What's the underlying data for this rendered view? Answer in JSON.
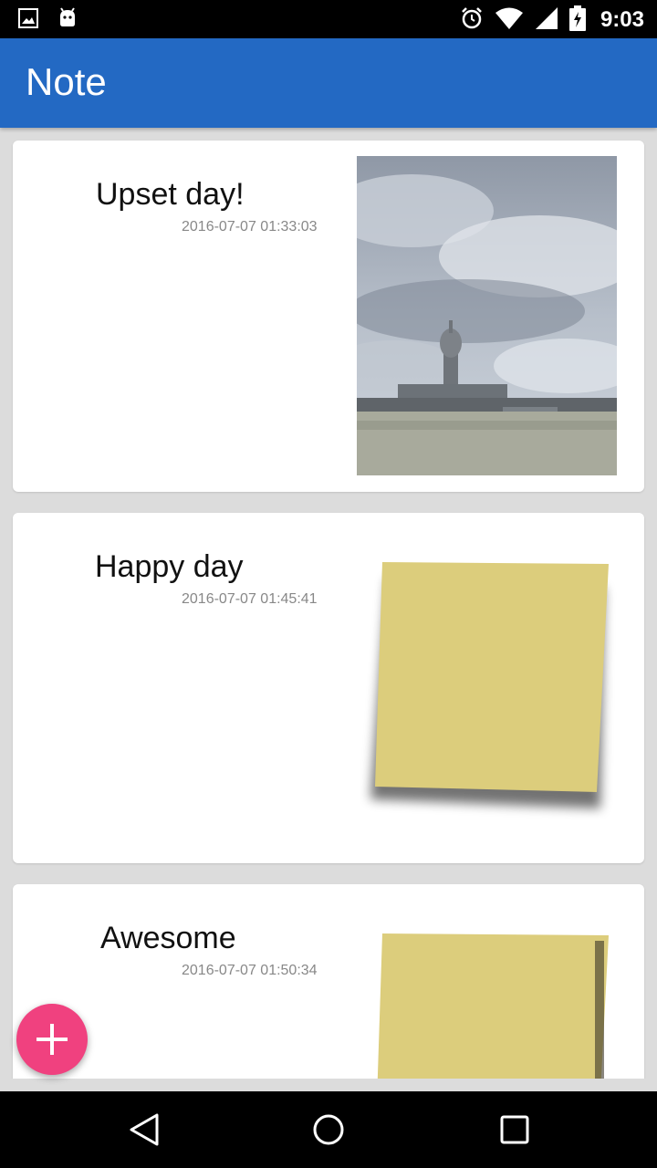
{
  "status_bar": {
    "time": "9:03",
    "left_icons": [
      "gallery-icon",
      "android-icon"
    ],
    "right_icons": [
      "alarm-icon",
      "wifi-icon",
      "signal-icon",
      "battery-icon"
    ]
  },
  "app_bar": {
    "title": "Note"
  },
  "notes": [
    {
      "title": "Upset day!",
      "timestamp": "2016-07-07 01:33:03",
      "image": "city-photo"
    },
    {
      "title": "Happy day",
      "timestamp": "2016-07-07 01:45:41",
      "image": "sticky-note"
    },
    {
      "title": "Awesome",
      "timestamp": "2016-07-07 01:50:34",
      "image": "sticky-note"
    }
  ],
  "fab": {
    "icon": "plus-icon",
    "color": "#f0417f"
  },
  "nav_bar": {
    "icons": [
      "back-icon",
      "home-icon",
      "recents-icon"
    ]
  },
  "colors": {
    "primary": "#2369c3",
    "accent": "#f0417f",
    "background": "#dcdcdc"
  }
}
